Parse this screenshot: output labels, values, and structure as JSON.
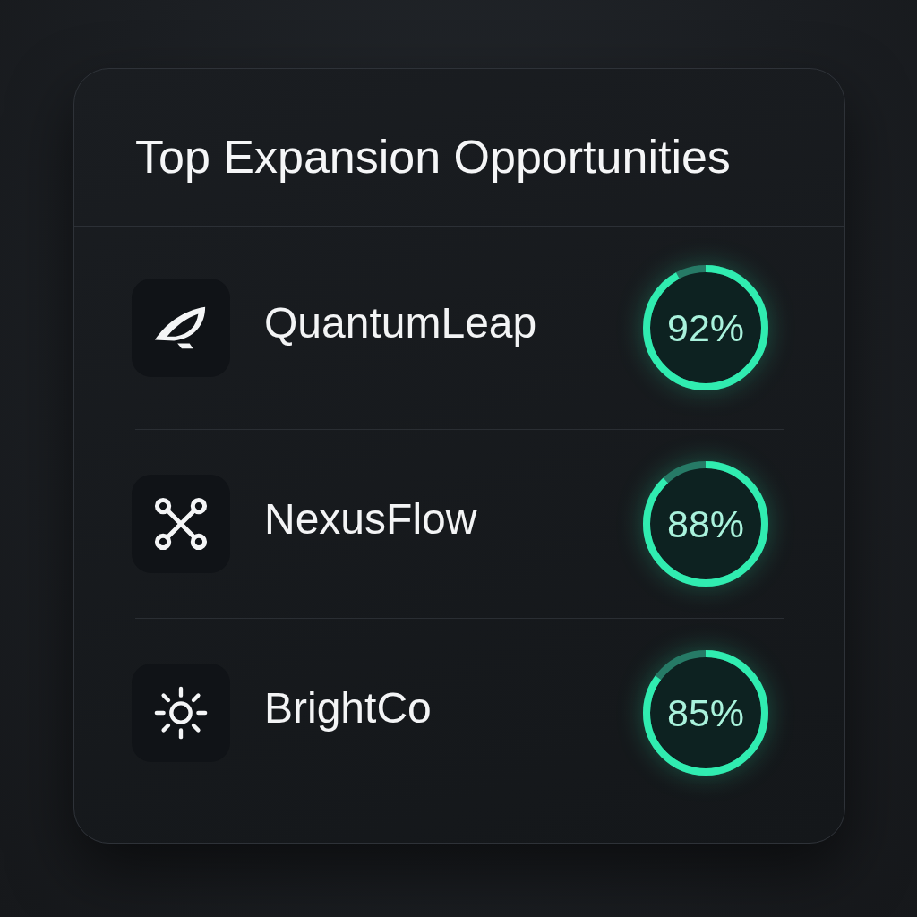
{
  "card": {
    "title": "Top Expansion Opportunities"
  },
  "rows": [
    {
      "name": "QuantumLeap",
      "level": 0.92,
      "reading": "92%"
    },
    {
      "name": "NexusFlow",
      "level": 0.88,
      "reading": "88%"
    },
    {
      "name": "BrightCo",
      "level": 0.85,
      "reading": "85%"
    }
  ]
}
